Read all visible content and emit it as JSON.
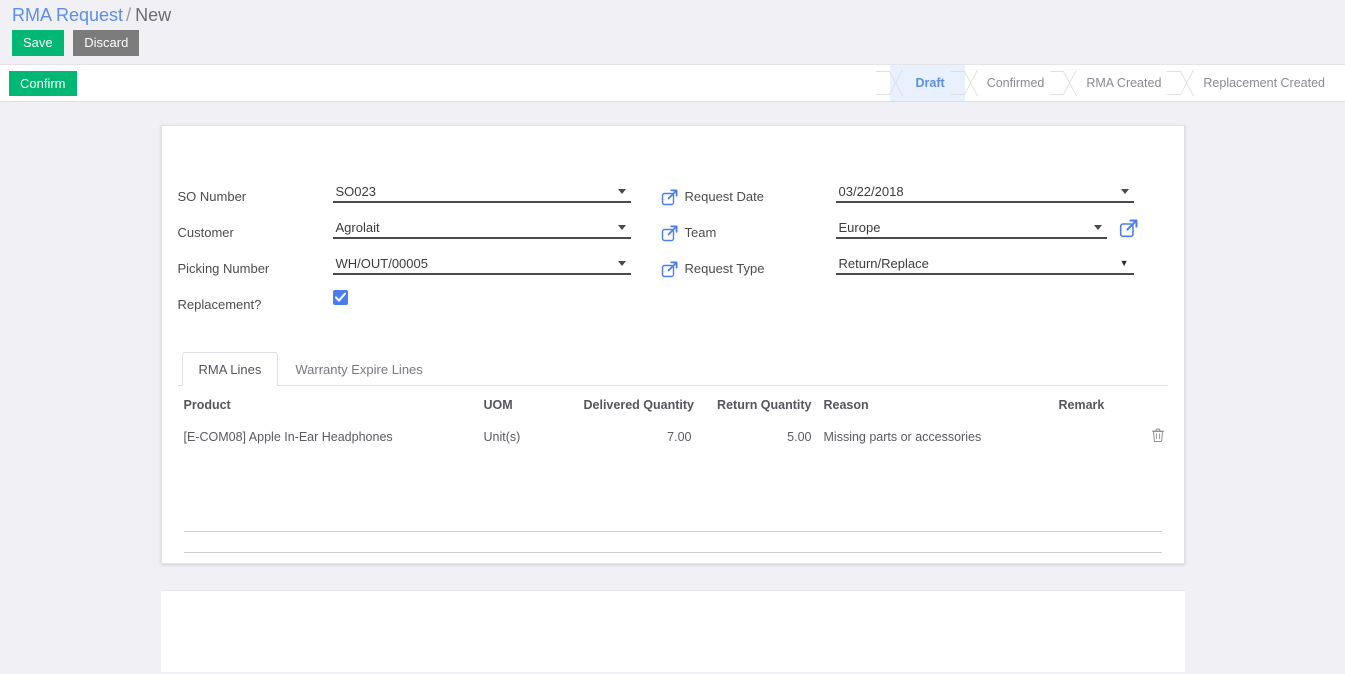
{
  "breadcrumb": {
    "root": "RMA Request",
    "separator": "/",
    "current": "New"
  },
  "edit_bar": {
    "save_label": "Save",
    "discard_label": "Discard"
  },
  "control_panel": {
    "confirm_label": "Confirm",
    "statusbar": [
      {
        "label": "Draft",
        "active": true
      },
      {
        "label": "Confirmed",
        "active": false
      },
      {
        "label": "RMA Created",
        "active": false
      },
      {
        "label": "Replacement Created",
        "active": false
      }
    ]
  },
  "form": {
    "left": [
      {
        "label": "SO Number",
        "value": "SO023",
        "widget": "many2one"
      },
      {
        "label": "Customer",
        "value": "Agrolait",
        "widget": "many2one"
      },
      {
        "label": "Picking Number",
        "value": "WH/OUT/00005",
        "widget": "many2one"
      },
      {
        "label": "Replacement?",
        "value": "",
        "widget": "checkbox",
        "checked": true
      }
    ],
    "right": [
      {
        "label": "Request Date",
        "value": "03/22/2018",
        "widget": "date",
        "icon": "external-link-icon",
        "trailing_icon": false
      },
      {
        "label": "Team",
        "value": "Europe",
        "widget": "many2one",
        "icon": "external-link-icon",
        "trailing_icon": true
      },
      {
        "label": "Request Type",
        "value": "Return/Replace",
        "widget": "select",
        "icon": "external-link-icon",
        "trailing_icon": false
      }
    ]
  },
  "notebook": {
    "tabs": [
      {
        "label": "RMA Lines",
        "active": true
      },
      {
        "label": "Warranty Expire Lines",
        "active": false
      }
    ],
    "table": {
      "columns": [
        "Product",
        "UOM",
        "Delivered Quantity",
        "Return Quantity",
        "Reason",
        "Remark",
        ""
      ],
      "rows": [
        {
          "product": "[E-COM08] Apple In-Ear Headphones",
          "uom": "Unit(s)",
          "delivered_quantity": "7.00",
          "return_quantity": "5.00",
          "reason": "Missing parts or accessories",
          "remark": "",
          "delete_icon": "trash-icon"
        }
      ]
    }
  },
  "colors": {
    "accent_green": "#00b873",
    "accent_blue": "#5b8fe8",
    "checkbox_blue": "#4a7ef0",
    "page_background": "#f0f0f5"
  }
}
